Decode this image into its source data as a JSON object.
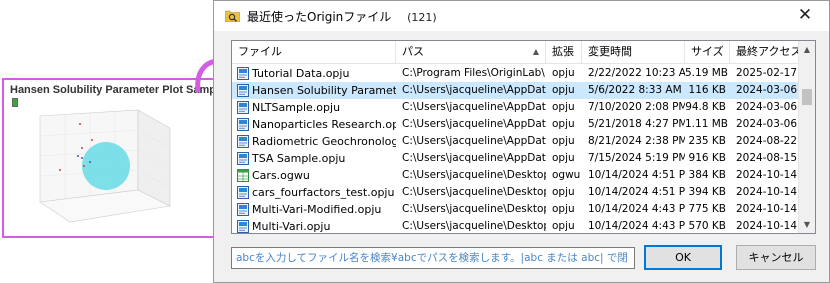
{
  "preview": {
    "title": "Hansen Solubility Parameter Plot Sample.opju",
    "border_color": "#d35ee3"
  },
  "dialog": {
    "title": "最近使ったOriginファイル",
    "count": "(121)",
    "close_icon": "close-icon",
    "columns": [
      "ファイル",
      "パス",
      "拡張",
      "変更時間",
      "サイズ",
      "最終アクセス"
    ],
    "rows": [
      {
        "name": "Tutorial Data.opju",
        "path": "C:\\Program Files\\OriginLab\\...",
        "ext": "opju",
        "modified": "2/22/2022 10:23 AM",
        "size": "5.19 MB",
        "last": "2025-02-17",
        "icon": "project",
        "selected": false
      },
      {
        "name": "Hansen Solubility Parameter...",
        "path": "C:\\Users\\jacqueline\\AppData...",
        "ext": "opju",
        "modified": "5/6/2022 8:33 AM",
        "size": "116 KB",
        "last": "2024-03-06",
        "icon": "project",
        "selected": true
      },
      {
        "name": "NLTSample.opju",
        "path": "C:\\Users\\jacqueline\\AppData...",
        "ext": "opju",
        "modified": "7/10/2020 2:08 PM",
        "size": "94.8 KB",
        "last": "2024-03-06",
        "icon": "project",
        "selected": false
      },
      {
        "name": "Nanoparticles Research.opju",
        "path": "C:\\Users\\jacqueline\\AppData...",
        "ext": "opju",
        "modified": "5/21/2018 4:27 PM",
        "size": "1.11 MB",
        "last": "2024-03-06",
        "icon": "project",
        "selected": false
      },
      {
        "name": "Radiometric Geochronology...",
        "path": "C:\\Users\\jacqueline\\AppData...",
        "ext": "opju",
        "modified": "8/21/2024 2:38 PM",
        "size": "235 KB",
        "last": "2024-08-22",
        "icon": "project",
        "selected": false
      },
      {
        "name": "TSA Sample.opju",
        "path": "C:\\Users\\jacqueline\\AppData...",
        "ext": "opju",
        "modified": "7/15/2024 5:19 PM",
        "size": "916 KB",
        "last": "2024-08-15",
        "icon": "project",
        "selected": false
      },
      {
        "name": "Cars.ogwu",
        "path": "C:\\Users\\jacqueline\\Desktop\\...",
        "ext": "ogwu",
        "modified": "10/14/2024 4:51 PM",
        "size": "384 KB",
        "last": "2024-10-14",
        "icon": "workbook",
        "selected": false
      },
      {
        "name": "cars_fourfactors_test.opju",
        "path": "C:\\Users\\jacqueline\\Desktop\\...",
        "ext": "opju",
        "modified": "10/14/2024 4:51 PM",
        "size": "394 KB",
        "last": "2024-10-14",
        "icon": "project",
        "selected": false
      },
      {
        "name": "Multi-Vari-Modified.opju",
        "path": "C:\\Users\\jacqueline\\Desktop\\...",
        "ext": "opju",
        "modified": "10/14/2024 4:43 PM",
        "size": "775 KB",
        "last": "2024-10-14",
        "icon": "project",
        "selected": false
      },
      {
        "name": "Multi-Vari.opju",
        "path": "C:\\Users\\jacqueline\\Desktop\\...",
        "ext": "opju",
        "modified": "10/14/2024 4:43 PM",
        "size": "570 KB",
        "last": "2024-10-14",
        "icon": "project",
        "selected": false
      }
    ],
    "search_text": "abcを入力してファイル名を検索¥abcでパスを検索します。|abc または abc| で閉",
    "ok_label": "OK",
    "cancel_label": "キャンセル",
    "selection_color": "#cce8ff"
  }
}
